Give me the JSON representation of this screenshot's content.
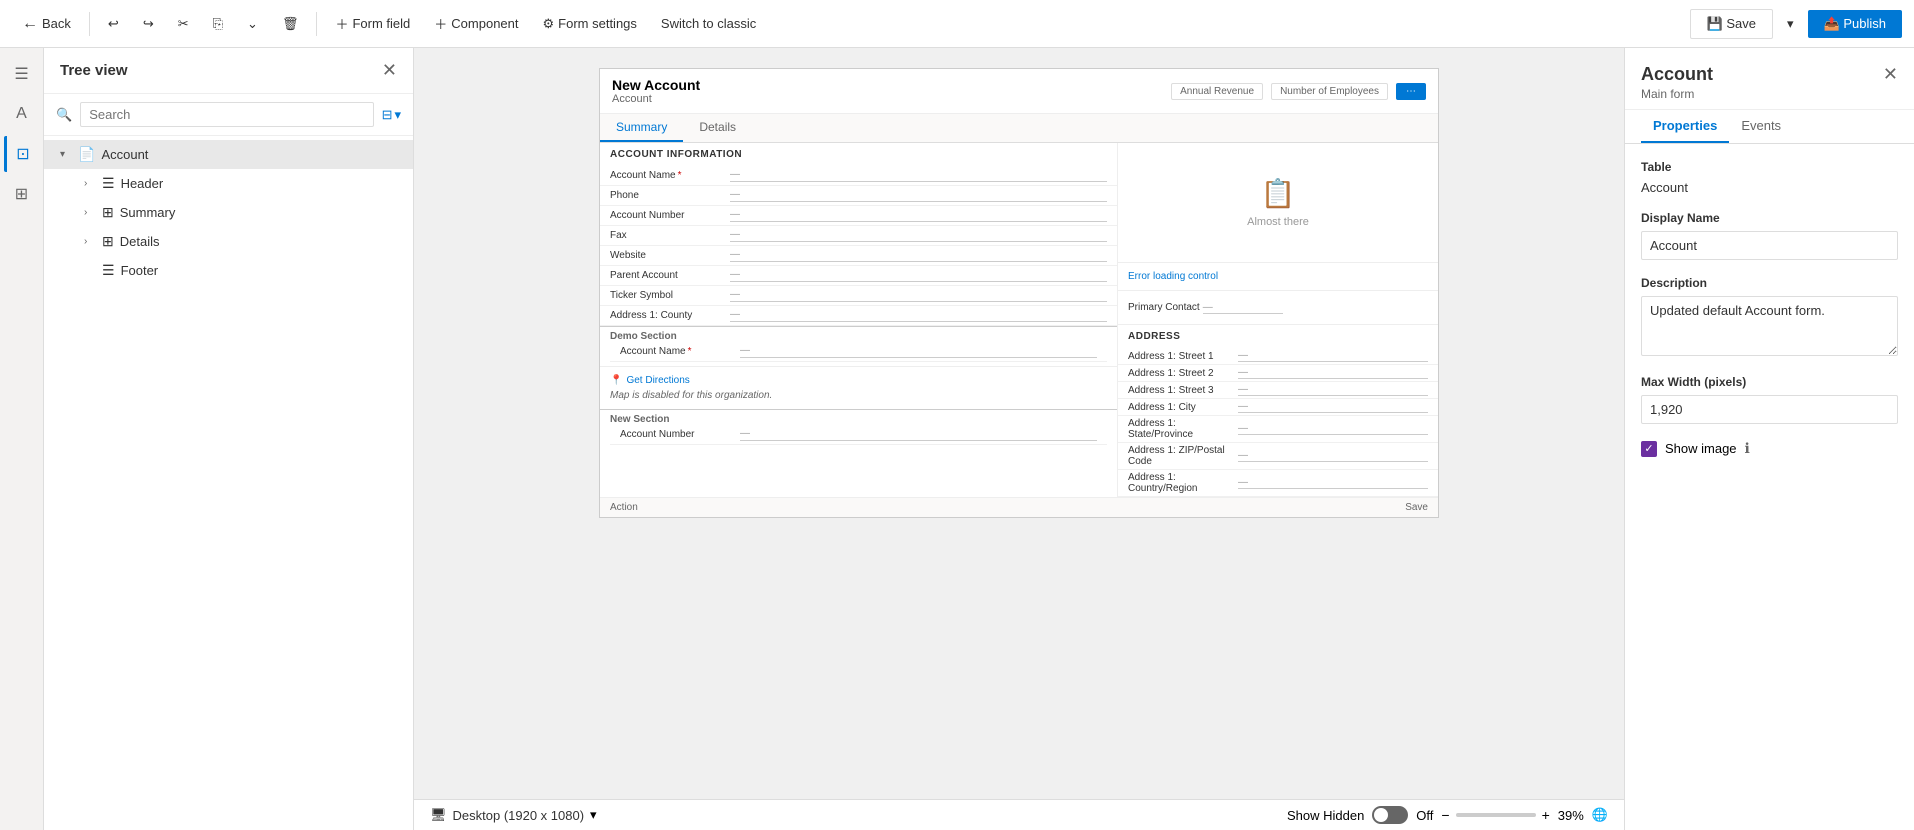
{
  "toolbar": {
    "back_label": "Back",
    "undo_icon": "↩",
    "redo_icon": "↪",
    "cut_icon": "✂",
    "copy_icon": "⎘",
    "more_icon": "⌄",
    "delete_icon": "🗑",
    "form_field_label": "Form field",
    "component_label": "Component",
    "form_settings_label": "Form settings",
    "switch_classic_label": "Switch to classic",
    "save_label": "Save",
    "save_dropdown": "▾",
    "publish_label": "Publish"
  },
  "tree_panel": {
    "title": "Tree view",
    "close_icon": "✕",
    "search_placeholder": "Search",
    "filter_icon": "⊟",
    "filter_arrow": "▾",
    "items": [
      {
        "id": "account",
        "label": "Account",
        "indent": 0,
        "expandable": true,
        "expanded": true,
        "icon": "📄",
        "selected": true
      },
      {
        "id": "header",
        "label": "Header",
        "indent": 1,
        "expandable": true,
        "expanded": false,
        "icon": "☰"
      },
      {
        "id": "summary",
        "label": "Summary",
        "indent": 1,
        "expandable": true,
        "expanded": false,
        "icon": "⊞"
      },
      {
        "id": "details",
        "label": "Details",
        "indent": 1,
        "expandable": true,
        "expanded": false,
        "icon": "⊞"
      },
      {
        "id": "footer",
        "label": "Footer",
        "indent": 1,
        "expandable": false,
        "expanded": false,
        "icon": "☰"
      }
    ]
  },
  "left_icons": [
    {
      "id": "hamburger",
      "icon": "☰",
      "active": false
    },
    {
      "id": "text",
      "icon": "A",
      "active": false
    },
    {
      "id": "layers",
      "icon": "⊡",
      "active": true
    },
    {
      "id": "plugin",
      "icon": "⊞",
      "active": false
    }
  ],
  "form_preview": {
    "title": "New Account",
    "entity": "Account",
    "annual_revenue_label": "Annual Revenue",
    "num_employees_label": "Number of Employees",
    "tabs": [
      "Summary",
      "Details"
    ],
    "active_tab": "Summary",
    "account_info_section": "ACCOUNT INFORMATION",
    "fields": [
      {
        "label": "Account Name",
        "value": "—",
        "required": true
      },
      {
        "label": "Phone",
        "value": "—"
      },
      {
        "label": "Account Number",
        "value": "—"
      },
      {
        "label": "Fax",
        "value": "—"
      },
      {
        "label": "Website",
        "value": "—"
      },
      {
        "label": "Parent Account",
        "value": "—"
      },
      {
        "label": "Ticker Symbol",
        "value": "—"
      },
      {
        "label": "Address 1: County",
        "value": "—"
      }
    ],
    "demo_section_label": "Demo Section",
    "demo_fields": [
      {
        "label": "Account Name",
        "value": "—",
        "required": true
      }
    ],
    "new_section_label": "New Section",
    "new_section_fields": [
      {
        "label": "Account Number",
        "value": "—"
      }
    ],
    "map_get_directions": "Get Directions",
    "map_disabled": "Map is disabled for this organization.",
    "timeline_label": "Almost there",
    "error_loading": "Error loading control",
    "primary_contact_label": "Primary Contact",
    "primary_contact_value": "—",
    "address_section_label": "ADDRESS",
    "address_fields": [
      {
        "label": "Address 1: Street 1",
        "value": "—"
      },
      {
        "label": "Address 1: Street 2",
        "value": "—"
      },
      {
        "label": "Address 1: Street 3",
        "value": "—"
      },
      {
        "label": "Address 1: City",
        "value": "—"
      },
      {
        "label": "Address 1: State/Province",
        "value": "—"
      },
      {
        "label": "Address 1: ZIP/Postal Code",
        "value": "—"
      },
      {
        "label": "Address 1: Country/Region",
        "value": "—"
      }
    ],
    "footer_action_label": "Action",
    "footer_save_label": "Save"
  },
  "canvas_bottom": {
    "desktop_label": "Desktop (1920 x 1080)",
    "desktop_icon": "🖥",
    "dropdown_arrow": "▾",
    "show_hidden_label": "Show Hidden",
    "toggle_state": "Off",
    "zoom_minus": "−",
    "zoom_plus": "+",
    "zoom_percent": "39%",
    "globe_icon": "🌐"
  },
  "right_panel": {
    "title": "Account",
    "subtitle": "Main form",
    "close_icon": "✕",
    "tabs": [
      "Properties",
      "Events"
    ],
    "active_tab": "Properties",
    "table_label": "Table",
    "table_value": "Account",
    "display_name_label": "Display Name",
    "display_name_value": "Account",
    "description_label": "Description",
    "description_value": "Updated default Account form.",
    "max_width_label": "Max Width (pixels)",
    "max_width_value": "1,920",
    "show_image_label": "Show image",
    "show_image_checked": true,
    "info_icon": "ℹ"
  }
}
